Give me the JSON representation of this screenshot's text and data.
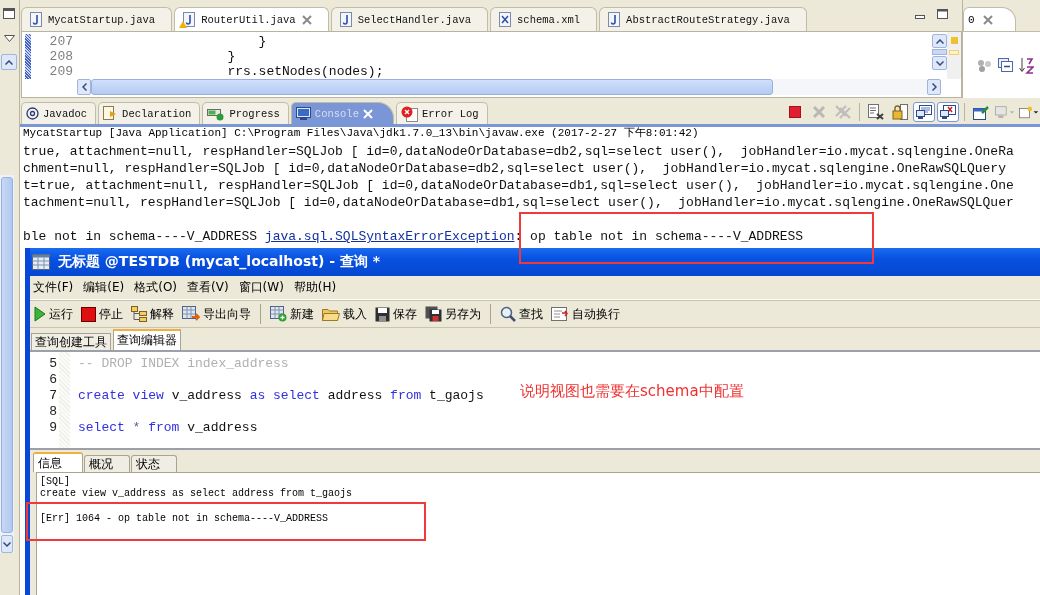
{
  "editor_tabs": [
    {
      "label": "MycatStartup.java",
      "kind": "java",
      "selected": false,
      "warning": false
    },
    {
      "label": "RouterUtil.java",
      "kind": "java",
      "selected": true,
      "warning": true
    },
    {
      "label": "SelectHandler.java",
      "kind": "java",
      "selected": false,
      "warning": false
    },
    {
      "label": "schema.xml",
      "kind": "xml",
      "selected": false,
      "warning": false
    },
    {
      "label": "AbstractRouteStrategy.java",
      "kind": "java",
      "selected": false,
      "warning": false
    }
  ],
  "code_lines": [
    {
      "number": "207",
      "text": "            }"
    },
    {
      "number": "208",
      "text": "        }"
    },
    {
      "number": "209",
      "text": "        rrs.setNodes(nodes);"
    }
  ],
  "outline_panel": {
    "tab": "0"
  },
  "console_tabs": [
    {
      "label": "Javadoc",
      "kind": "javadoc",
      "selected": false
    },
    {
      "label": "Declaration",
      "kind": "declaration",
      "selected": false
    },
    {
      "label": "Progress",
      "kind": "progress",
      "selected": false
    },
    {
      "label": "Console",
      "kind": "console",
      "selected": true
    },
    {
      "label": "Error Log",
      "kind": "errorlog",
      "selected": false
    }
  ],
  "console_toolbar": [
    {
      "kind": "terminate",
      "disabled": false,
      "pressed": false
    },
    {
      "kind": "remove",
      "disabled": true,
      "pressed": false
    },
    {
      "kind": "remove_all",
      "disabled": true,
      "pressed": false
    },
    {
      "kind": "clear",
      "disabled": false,
      "pressed": false
    },
    {
      "kind": "scroll_lock",
      "disabled": false,
      "pressed": false
    },
    {
      "kind": "show_stdout",
      "disabled": false,
      "pressed": true
    },
    {
      "kind": "show_stderr",
      "disabled": false,
      "pressed": true
    },
    {
      "kind": "pin",
      "disabled": false,
      "pressed": false
    },
    {
      "kind": "display",
      "disabled": true,
      "pressed": false
    },
    {
      "kind": "open",
      "disabled": false,
      "pressed": false
    }
  ],
  "console": {
    "header": "MycatStartup [Java Application] C:\\Program Files\\Java\\jdk1.7.0_13\\bin\\javaw.exe (2017-2-27 下午8:01:42)",
    "lines": [
      {
        "text": "true, attachment=null, respHandler=SQLJob [ id=0,dataNodeOrDatabase=db2,sql=select user(),  jobHandler=io.mycat.sqlengine.OneRa"
      },
      {
        "text": "chment=null, respHandler=SQLJob [ id=0,dataNodeOrDatabase=db2,sql=select user(),  jobHandler=io.mycat.sqlengine.OneRawSQLQuery"
      },
      {
        "text": "t=true, attachment=null, respHandler=SQLJob [ id=0,dataNodeOrDatabase=db1,sql=select user(),  jobHandler=io.mycat.sqlengine.One"
      },
      {
        "text": "tachment=null, respHandler=SQLJob [ id=0,dataNodeOrDatabase=db1,sql=select user(),  jobHandler=io.mycat.sqlengine.OneRawSQLQuer"
      }
    ],
    "error": {
      "prefix": "ble not in schema----V_ADDRESS",
      "link": "java.sql.SQLSyntaxErrorException",
      "suffix": ": op table not in schema----V_ADDRESS"
    }
  },
  "query_window": {
    "title": "无标题 @TESTDB (mycat_localhost) - 查询 *",
    "menu": [
      "文件(F)",
      "编辑(E)",
      "格式(O)",
      "查看(V)",
      "窗口(W)",
      "帮助(H)"
    ],
    "toolbar_groups": [
      [
        {
          "label": "运行",
          "kind": "run"
        },
        {
          "label": "停止",
          "kind": "stop"
        },
        {
          "label": "解释",
          "kind": "explain"
        },
        {
          "label": "导出向导",
          "kind": "export"
        }
      ],
      [
        {
          "label": "新建",
          "kind": "new"
        },
        {
          "label": "载入",
          "kind": "load"
        },
        {
          "label": "保存",
          "kind": "save"
        },
        {
          "label": "另存为",
          "kind": "saveas"
        }
      ],
      [
        {
          "label": "查找",
          "kind": "find"
        },
        {
          "label": "自动换行",
          "kind": "wrap"
        }
      ]
    ],
    "tabs": [
      {
        "label": "查询创建工具",
        "selected": false
      },
      {
        "label": "查询编辑器",
        "selected": true
      }
    ],
    "sql_lines": [
      {
        "number": "5",
        "tokens": [
          {
            "text": "-- DROP INDEX index_address",
            "kind": "comment"
          }
        ]
      },
      {
        "number": "6"
      },
      {
        "number": "7",
        "tokens": [
          {
            "text": "create view",
            "kind": "keyword"
          },
          {
            "text": " v_address ",
            "kind": "plain"
          },
          {
            "text": "as select",
            "kind": "keyword"
          },
          {
            "text": " address ",
            "kind": "plain"
          },
          {
            "text": "from",
            "kind": "keyword"
          },
          {
            "text": " t_gaojs",
            "kind": "plain"
          }
        ]
      },
      {
        "number": "8"
      },
      {
        "number": "9",
        "tokens": [
          {
            "text": "select",
            "kind": "keyword"
          },
          {
            "text": " * ",
            "kind": "operator"
          },
          {
            "text": "from",
            "kind": "keyword"
          },
          {
            "text": " v_address",
            "kind": "plain"
          }
        ]
      }
    ],
    "note": "说明视图也需要在schema中配置",
    "result_tabs": [
      {
        "label": "信息",
        "selected": true
      },
      {
        "label": "概况",
        "selected": false
      },
      {
        "label": "状态",
        "selected": false
      }
    ],
    "messages": [
      "[SQL]",
      "create view v_address as select address from t_gaojs",
      "[Err] 1064 - op table not in schema----V_ADDRESS"
    ]
  }
}
